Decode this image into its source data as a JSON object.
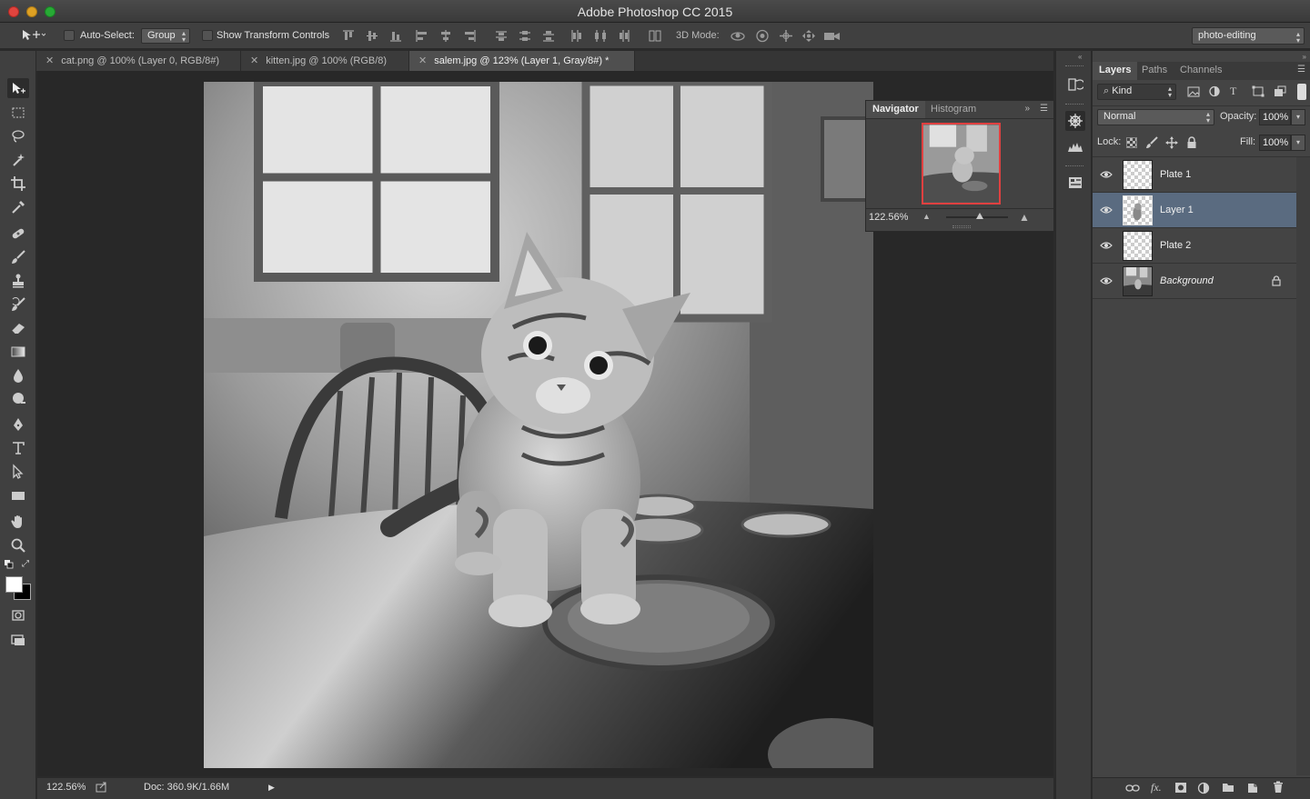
{
  "app": {
    "title": "Adobe Photoshop CC 2015"
  },
  "options_bar": {
    "auto_select_label": "Auto-Select:",
    "auto_select_checked": false,
    "auto_select_target": "Group",
    "show_transform_label": "Show Transform Controls",
    "show_transform_checked": false,
    "mode_3d_label": "3D Mode:",
    "workspace": "photo-editing"
  },
  "tabs": [
    {
      "label": "cat.png @ 100% (Layer 0, RGB/8#)",
      "active": false
    },
    {
      "label": "kitten.jpg @ 100% (RGB/8)",
      "active": false
    },
    {
      "label": "salem.jpg @ 123% (Layer 1, Gray/8#) *",
      "active": true
    }
  ],
  "tools": [
    "move-tool",
    "marquee-tool",
    "lasso-tool",
    "magic-wand-tool",
    "crop-tool",
    "eyedropper-tool",
    "healing-brush-tool",
    "brush-tool",
    "clone-stamp-tool",
    "history-brush-tool",
    "eraser-tool",
    "gradient-tool",
    "blur-tool",
    "dodge-tool",
    "pen-tool",
    "type-tool",
    "path-selection-tool",
    "rectangle-tool",
    "hand-tool",
    "zoom-tool"
  ],
  "navigator": {
    "tabs": [
      "Navigator",
      "Histogram"
    ],
    "zoom": "122.56%",
    "zoom_slider_position": 0.55
  },
  "status_bar": {
    "zoom": "122.56%",
    "doc_info": "Doc: 360.9K/1.66M"
  },
  "layers_panel": {
    "tabs": [
      "Layers",
      "Paths",
      "Channels"
    ],
    "filter_kind": "Kind",
    "blend_mode": "Normal",
    "opacity_label": "Opacity:",
    "opacity": "100%",
    "lock_label": "Lock:",
    "fill_label": "Fill:",
    "fill": "100%",
    "layers": [
      {
        "name": "Plate 1",
        "selected": false,
        "visible": true,
        "locked": false,
        "italic": false
      },
      {
        "name": "Layer 1",
        "selected": true,
        "visible": true,
        "locked": false,
        "italic": false
      },
      {
        "name": "Plate 2",
        "selected": false,
        "visible": true,
        "locked": false,
        "italic": false
      },
      {
        "name": "Background",
        "selected": false,
        "visible": true,
        "locked": true,
        "italic": true
      }
    ]
  },
  "colors": {
    "foreground": "#ffffff",
    "background": "#000000",
    "selection_row": "#5a6b80",
    "navigator_view_box": "#e04040"
  }
}
